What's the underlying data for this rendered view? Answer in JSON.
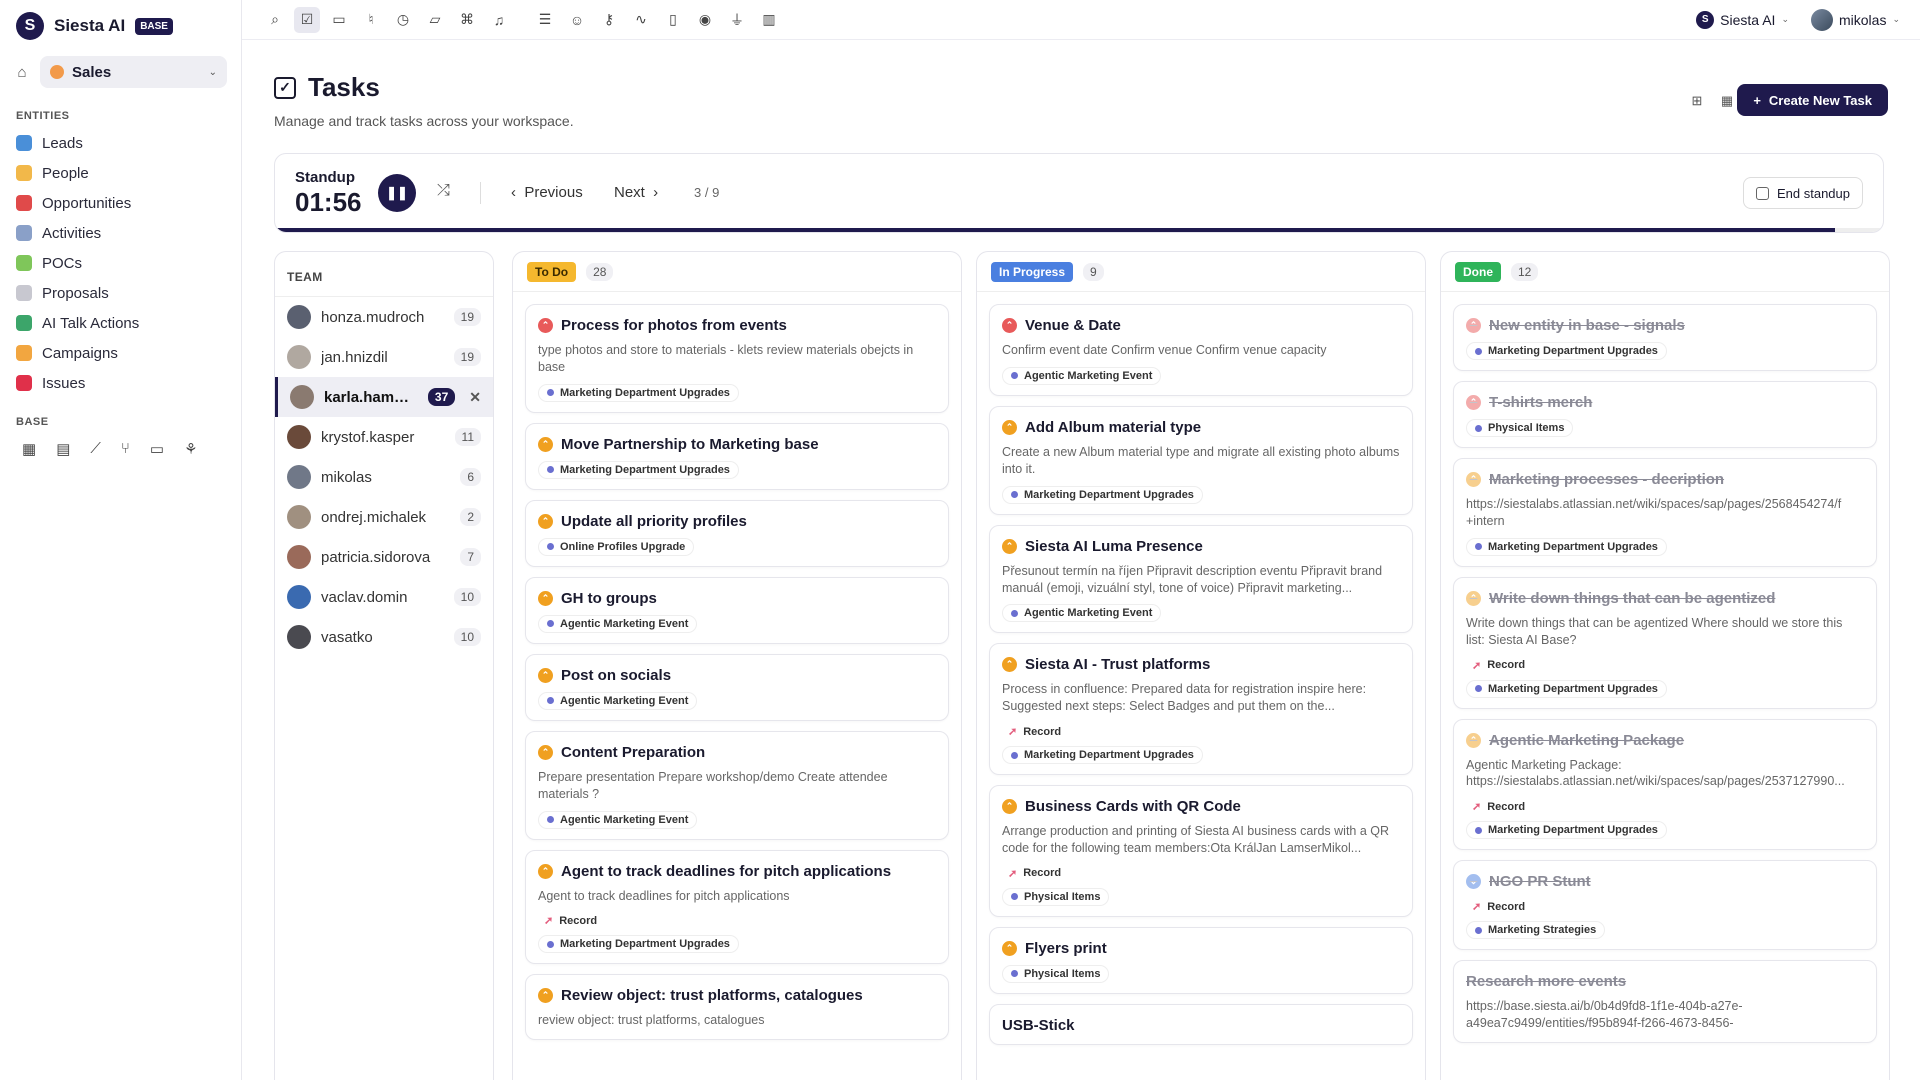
{
  "brand": {
    "name": "Siesta AI",
    "badge": "BASE",
    "logo_letter": "S"
  },
  "workspace": {
    "name": "Sales"
  },
  "sidebar": {
    "entities_label": "ENTITIES",
    "items": [
      {
        "label": "Leads",
        "color": "#4a8fd8"
      },
      {
        "label": "People",
        "color": "#f2b84a"
      },
      {
        "label": "Opportunities",
        "color": "#e04a4a"
      },
      {
        "label": "Activities",
        "color": "#8aa0c8"
      },
      {
        "label": "POCs",
        "color": "#7fc65a"
      },
      {
        "label": "Proposals",
        "color": "#c8c8d0"
      },
      {
        "label": "AI Talk Actions",
        "color": "#3ca56a"
      },
      {
        "label": "Campaigns",
        "color": "#f2a640"
      },
      {
        "label": "Issues",
        "color": "#e0304a"
      }
    ],
    "base_label": "BASE"
  },
  "topbar": {
    "org": "Siesta AI",
    "user": "mikolas"
  },
  "page": {
    "title": "Tasks",
    "subtitle": "Manage and track tasks across your workspace.",
    "create_button": "Create New Task"
  },
  "standup": {
    "label": "Standup",
    "time": "01:56",
    "prev": "Previous",
    "next": "Next",
    "position": "3 / 9",
    "end_label": "End standup",
    "progress": 0.97
  },
  "team": {
    "label": "TEAM",
    "members": [
      {
        "name": "honza.mudroch",
        "count": "19",
        "active": false,
        "color": "#5a6070"
      },
      {
        "name": "jan.hnizdil",
        "count": "19",
        "active": false,
        "color": "#b0a8a0"
      },
      {
        "name": "karla.hambe...",
        "count": "37",
        "active": true,
        "color": "#8a7a70"
      },
      {
        "name": "krystof.kasper",
        "count": "11",
        "active": false,
        "color": "#6a4a3a"
      },
      {
        "name": "mikolas",
        "count": "6",
        "active": false,
        "color": "#707888"
      },
      {
        "name": "ondrej.michalek",
        "count": "2",
        "active": false,
        "color": "#a09080"
      },
      {
        "name": "patricia.sidorova",
        "count": "7",
        "active": false,
        "color": "#9a6a5a"
      },
      {
        "name": "vaclav.domin",
        "count": "10",
        "active": false,
        "color": "#3a6ab0"
      },
      {
        "name": "vasatko",
        "count": "10",
        "active": false,
        "color": "#4a4a50"
      }
    ]
  },
  "columns": [
    {
      "status": "To Do",
      "count": "28",
      "badge_bg": "#f5b82e",
      "badge_fg": "#3a2a00",
      "cls": "",
      "cards": [
        {
          "title": "Process for photos from events",
          "prio": "#e85a5a",
          "desc": "type photos and store to materials - klets review materials obejcts in base",
          "record": "",
          "tag": "Marketing Department Upgrades"
        },
        {
          "title": "Move Partnership to Marketing base",
          "prio": "#f0a020",
          "desc": "",
          "record": "",
          "tag": "Marketing Department Upgrades"
        },
        {
          "title": "Update all priority profiles",
          "prio": "#f0a020",
          "desc": "",
          "record": "",
          "tag": "Online Profiles Upgrade"
        },
        {
          "title": "GH to groups",
          "prio": "#f0a020",
          "desc": "",
          "record": "",
          "tag": "Agentic Marketing Event"
        },
        {
          "title": "Post on socials",
          "prio": "#f0a020",
          "desc": "",
          "record": "",
          "tag": "Agentic Marketing Event"
        },
        {
          "title": "Content Preparation",
          "prio": "#f0a020",
          "desc": "Prepare presentation Prepare workshop/demo Create attendee materials ?",
          "record": "",
          "tag": "Agentic Marketing Event"
        },
        {
          "title": "Agent to track deadlines for pitch applications",
          "prio": "#f0a020",
          "desc": "Agent to track deadlines for pitch applications",
          "record": "Record",
          "tag": "Marketing Department Upgrades"
        },
        {
          "title": "Review object: trust platforms, catalogues",
          "prio": "#f0a020",
          "desc": "review object: trust platforms, catalogues",
          "record": "",
          "tag": ""
        }
      ]
    },
    {
      "status": "In Progress",
      "count": "9",
      "badge_bg": "#4a7fe0",
      "badge_fg": "#ffffff",
      "cls": "",
      "cards": [
        {
          "title": "Venue & Date",
          "prio": "#e85a5a",
          "desc": "Confirm event date Confirm venue Confirm venue capacity",
          "record": "",
          "tag": "Agentic Marketing Event"
        },
        {
          "title": "Add Album material type",
          "prio": "#f0a020",
          "desc": "Create a new Album material type and migrate all existing photo albums into it.",
          "record": "",
          "tag": "Marketing Department Upgrades"
        },
        {
          "title": "Siesta AI Luma Presence",
          "prio": "#f0a020",
          "desc": "Přesunout termín na říjen Připravit description eventu Připravit brand manuál (emoji, vizuální styl, tone of voice) Připravit marketing...",
          "record": "",
          "tag": "Agentic Marketing Event"
        },
        {
          "title": "Siesta AI - Trust platforms",
          "prio": "#f0a020",
          "desc": "Process in confluence: Prepared data for registration inspire here: Suggested next steps: Select Badges and put them on the...",
          "record": "Record",
          "tag": "Marketing Department Upgrades"
        },
        {
          "title": "Business Cards with QR Code",
          "prio": "#f0a020",
          "desc": "Arrange production and printing of Siesta AI business cards with a QR code for the following team members:Ota KrálJan LamserMikol...",
          "record": "Record",
          "tag": "Physical Items"
        },
        {
          "title": "Flyers print",
          "prio": "#f0a020",
          "desc": "",
          "record": "",
          "tag": "Physical Items"
        },
        {
          "title": "USB-Stick",
          "prio": "",
          "desc": "",
          "record": "",
          "tag": ""
        }
      ]
    },
    {
      "status": "Done",
      "count": "12",
      "badge_bg": "#2fb45a",
      "badge_fg": "#ffffff",
      "cls": "done",
      "cards": [
        {
          "title": "New entity in base - signals",
          "prio": "#e85a5a",
          "desc": "",
          "record": "",
          "tag": "Marketing Department Upgrades"
        },
        {
          "title": "T-shirts merch",
          "prio": "#e85a5a",
          "desc": "",
          "record": "",
          "tag": "Physical Items"
        },
        {
          "title": "Marketing processes - decription",
          "prio": "#f0a020",
          "desc": "https://siestalabs.atlassian.net/wiki/spaces/sap/pages/2568454274/f +intern",
          "record": "",
          "tag": "Marketing Department Upgrades"
        },
        {
          "title": "Write down things that can be agentized",
          "prio": "#f0a020",
          "desc": "Write down things that can be agentized Where should we store this list: Siesta AI Base?",
          "record": "Record",
          "tag": "Marketing Department Upgrades"
        },
        {
          "title": "Agentic Marketing Package",
          "prio": "#f0a020",
          "desc": "Agentic Marketing Package: https://siestalabs.atlassian.net/wiki/spaces/sap/pages/2537127990...",
          "record": "Record",
          "tag": "Marketing Department Upgrades"
        },
        {
          "title": "NGO PR Stunt",
          "prio": "#4a7fe0",
          "desc": "",
          "record": "Record",
          "tag": "Marketing Strategies"
        },
        {
          "title": "Research more events",
          "prio": "",
          "desc": "https://base.siesta.ai/b/0b4d9fd8-1f1e-404b-a27e-a49ea7c9499/entities/f95b894f-f266-4673-8456-",
          "record": "",
          "tag": ""
        }
      ]
    }
  ]
}
